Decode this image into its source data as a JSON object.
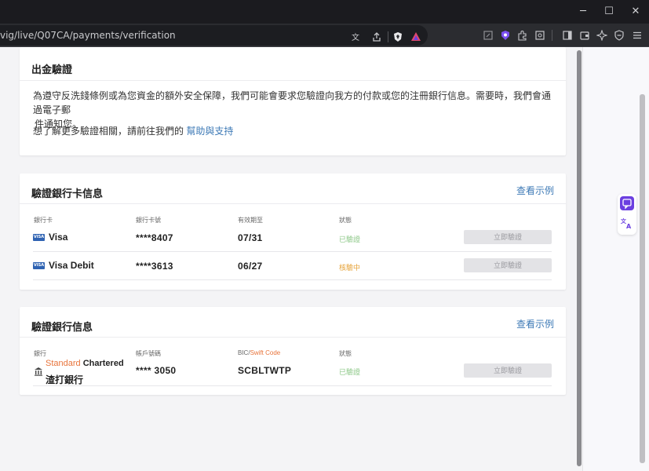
{
  "browser": {
    "url": "vig/live/Q07CA/payments/verification"
  },
  "withdrawal_card": {
    "title": "出金驗證",
    "description_line1": "為遵守反洗錢條例或為您資金的額外安全保障，我們可能會要求您驗證向我方的付款或您的注冊銀行信息。需要時，我們會通過電子郵",
    "description_line2": "件通知您。",
    "more_info_prefix": "想了解更多驗證相關，請前往我們的 ",
    "help_link": "幫助與支持"
  },
  "bank_card_section": {
    "title": "驗證銀行卡信息",
    "sample_link": "查看示例",
    "columns": [
      "銀行卡",
      "銀行卡號",
      "有效期至",
      "狀態"
    ],
    "rows": [
      {
        "card_logo": "VISA",
        "card_name": "Visa",
        "number": "****8407",
        "expiry": "07/31",
        "status": "已驗證",
        "button": "立即驗證"
      },
      {
        "card_logo": "VISA",
        "card_name": "Visa Debit",
        "number": "****3613",
        "expiry": "06/27",
        "status": "核驗中",
        "button": "立即驗證"
      }
    ]
  },
  "bank_account_section": {
    "title": "驗證銀行信息",
    "sample_link": "查看示例",
    "col_bank": "銀行",
    "col_account": "帳戶號碼",
    "col_bic_prefix": "BIC/",
    "col_bic_swift": "Swift Code",
    "col_status": "狀態",
    "row": {
      "bank_name_standard": "Standard",
      "bank_name_chartered": " Chartered",
      "bank_name_cn": "渣打銀行",
      "account": "**** 3050",
      "bic": "SCBLTWTP",
      "status": "已驗證",
      "button": "立即驗證"
    }
  },
  "colors": {
    "verified": "#8fc98a",
    "pending": "#e6a33a",
    "link": "#3e7ab6",
    "standard_orange": "#e8743b"
  },
  "icons": {
    "minimize": "─",
    "maximize": "☐",
    "close": "✕"
  }
}
